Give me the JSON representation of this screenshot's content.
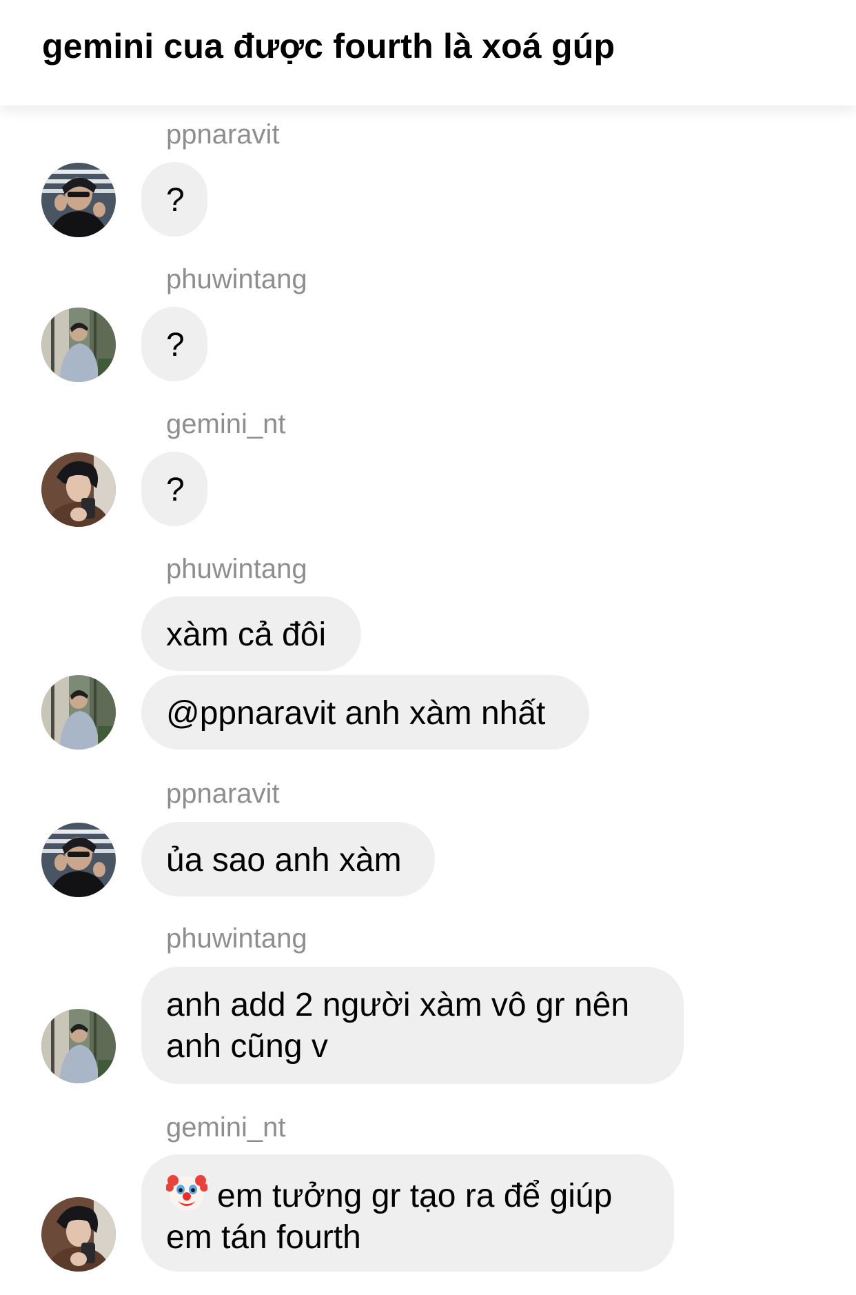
{
  "header": {
    "title": "gemini cua được fourth là xoá gúp"
  },
  "messages": [
    {
      "username": "ppnaravit",
      "avatar": "ppnaravit",
      "bubbles": [
        "?"
      ]
    },
    {
      "username": "phuwintang",
      "avatar": "phuwintang",
      "bubbles": [
        "?"
      ]
    },
    {
      "username": "gemini_nt",
      "avatar": "gemini_nt",
      "bubbles": [
        "?"
      ]
    },
    {
      "username": "phuwintang",
      "avatar": "phuwintang",
      "bubbles": [
        "xàm cả đôi",
        "@ppnaravit anh xàm nhất"
      ]
    },
    {
      "username": "ppnaravit",
      "avatar": "ppnaravit",
      "bubbles": [
        "ủa sao anh xàm"
      ]
    },
    {
      "username": "phuwintang",
      "avatar": "phuwintang",
      "bubbles": [
        "anh add 2 người xàm vô gr nên anh cũng v"
      ]
    },
    {
      "username": "gemini_nt",
      "avatar": "gemini_nt",
      "bubbles": [
        "em tưởng gr tạo ra để giúp em tán fourth"
      ],
      "emoji": "clown-face-emoji"
    }
  ],
  "colors": {
    "bubble_bg": "#efefef",
    "username": "#8e8e8e",
    "text": "#000000"
  }
}
